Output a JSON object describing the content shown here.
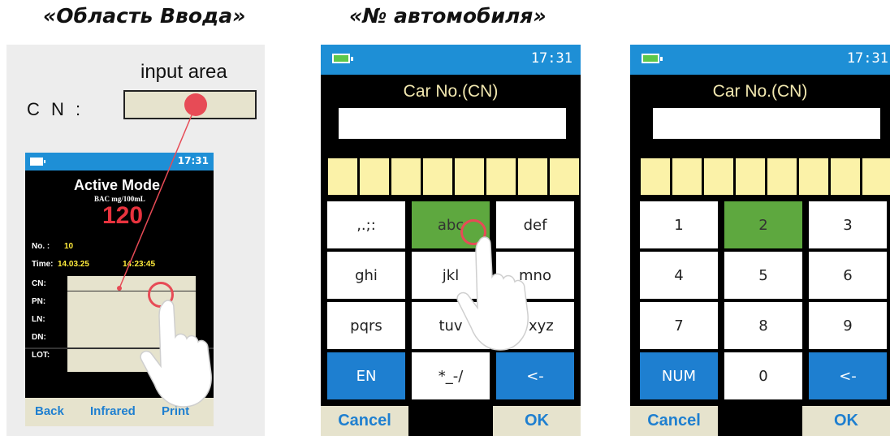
{
  "headers": {
    "left": "«Область Ввода»",
    "middle": "«№ автомобиля»"
  },
  "input_demo": {
    "input_area_label": "input area",
    "cn_label": "C N :",
    "mini_screen": {
      "time": "17:31",
      "mode_title": "Active Mode",
      "unit": "BAC mg/100mL",
      "value": "120",
      "fields": [
        {
          "label": "No. :",
          "value": "10"
        },
        {
          "label": "Time:",
          "value": "14.03.25"
        },
        {
          "label": "CN:",
          "value": ""
        },
        {
          "label": "PN:",
          "value": ""
        },
        {
          "label": "LN:",
          "value": ""
        },
        {
          "label": "DN:",
          "value": ""
        },
        {
          "label": "LOT:",
          "value": ""
        }
      ],
      "time_value2": "14:23:45",
      "footer": [
        "Back",
        "Infrared",
        "Print"
      ]
    }
  },
  "keyboard_letters": {
    "time": "17:31",
    "title": "Car No.(CN)",
    "keys": [
      ",.;:",
      "abc",
      "def",
      "ghi",
      "jkl",
      "mno",
      "pqrs",
      "tuv",
      "wxyz",
      "EN",
      "*_-/",
      "<-"
    ],
    "cancel": "Cancel",
    "ok": "OK"
  },
  "keyboard_numbers": {
    "time": "17:31",
    "title": "Car No.(CN)",
    "keys": [
      "1",
      "2",
      "3",
      "4",
      "5",
      "6",
      "7",
      "8",
      "9",
      "NUM",
      "0",
      "<-"
    ],
    "cancel": "Cancel",
    "ok": "OK"
  },
  "colors": {
    "status_bar": "#1e8fd6",
    "key_selected": "#5ea83f",
    "key_blue": "#1e7fd0",
    "cell_yellow": "#fbf2a8",
    "touch_red": "#e74b56"
  }
}
